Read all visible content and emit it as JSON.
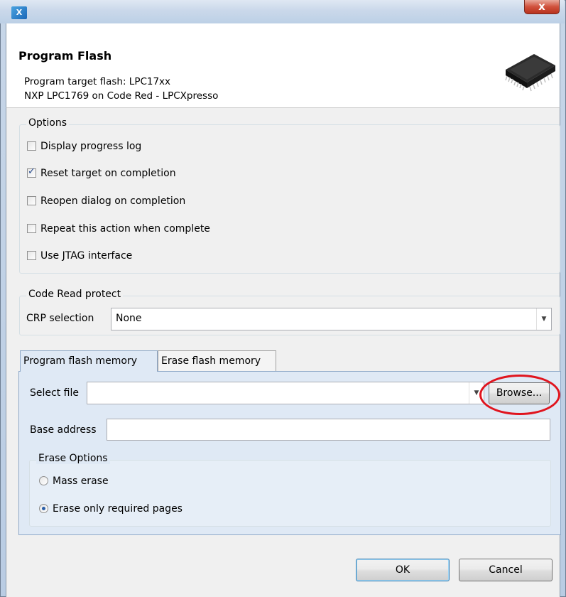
{
  "window": {
    "close_glyph": "x",
    "app_icon_letter": "X"
  },
  "dialog": {
    "title": "Program Flash",
    "target_line": "Program target flash: LPC17xx",
    "device_line": "NXP LPC1769 on Code Red - LPCXpresso"
  },
  "options": {
    "legend": "Options",
    "items": [
      {
        "label": "Display progress log",
        "checked": false
      },
      {
        "label": "Reset target on completion",
        "checked": true
      },
      {
        "label": "Reopen dialog on completion",
        "checked": false
      },
      {
        "label": "Repeat this action when complete",
        "checked": false
      },
      {
        "label": "Use JTAG interface",
        "checked": false
      }
    ]
  },
  "crp": {
    "legend": "Code Read protect",
    "label": "CRP selection",
    "value": "None"
  },
  "tabs": [
    {
      "label": "Program flash memory",
      "active": true
    },
    {
      "label": "Erase flash memory",
      "active": false
    }
  ],
  "program": {
    "select_file_label": "Select file",
    "select_file_value": "",
    "browse_label": "Browse...",
    "base_address_label": "Base address",
    "base_address_value": "",
    "erase_options": {
      "legend": "Erase Options",
      "mass_erase": "Mass erase",
      "required_pages": "Erase only required pages",
      "selected": "required_pages"
    }
  },
  "buttons": {
    "ok": "OK",
    "cancel": "Cancel"
  },
  "colors": {
    "highlight": "#e0141e",
    "tab_panel": "#dfe9f5",
    "dialog_bg": "#f0f0f0"
  }
}
